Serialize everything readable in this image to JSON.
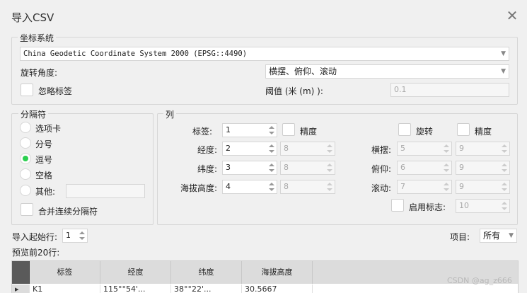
{
  "window": {
    "title": "导入CSV"
  },
  "crs": {
    "legend": "坐标系统",
    "value": "China Geodetic Coordinate System 2000 (EPSG::4490)",
    "rotation_label": "旋转角度:",
    "rotation_value": "横摆、俯仰、滚动",
    "ignore_label": "忽略标签",
    "threshold_label": "阈值 (米 (m) ):",
    "threshold_value": "0.1"
  },
  "separator": {
    "legend": "分隔符",
    "options": [
      "选项卡",
      "分号",
      "逗号",
      "空格",
      "其他:"
    ],
    "selected": "逗号",
    "merge_label": "合并连续分隔符"
  },
  "columns": {
    "legend": "列",
    "precision_label": "精度",
    "rotate_label": "旋转",
    "rows": [
      {
        "label": "标签:",
        "value": "1",
        "precision": ""
      },
      {
        "label": "经度:",
        "value": "2",
        "precision": "8"
      },
      {
        "label": "纬度:",
        "value": "3",
        "precision": "8"
      },
      {
        "label": "海拔高度:",
        "value": "4",
        "precision": "8"
      }
    ],
    "rot_rows": [
      {
        "label": "横摆:",
        "value": "5",
        "precision": "9"
      },
      {
        "label": "俯仰:",
        "value": "6",
        "precision": "9"
      },
      {
        "label": "滚动:",
        "value": "7",
        "precision": "9"
      }
    ],
    "flag_label": "启用标志:",
    "flag_value": "10"
  },
  "import_start": {
    "label": "导入起始行:",
    "value": "1"
  },
  "items": {
    "label": "项目:",
    "value": "所有"
  },
  "preview": {
    "label": "预览前20行:",
    "headers": [
      "标签",
      "经度",
      "纬度",
      "海拔高度"
    ],
    "row1": [
      "K1",
      "115°°54'...",
      "38°°22'...",
      "30.5667"
    ]
  },
  "watermark": "CSDN @ag_z666"
}
